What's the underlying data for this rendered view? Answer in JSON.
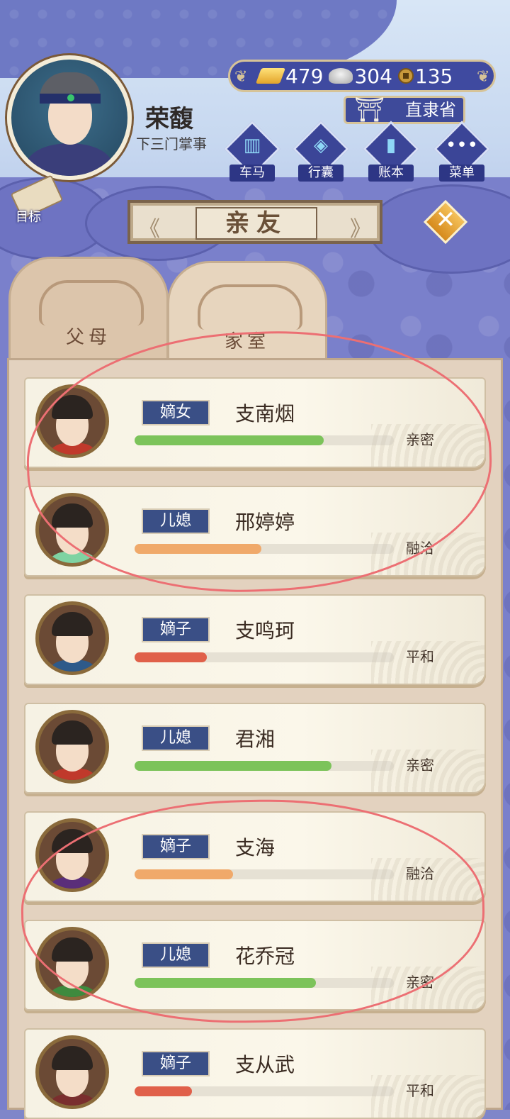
{
  "player": {
    "name": "荣馥",
    "title": "下三门掌事"
  },
  "currency": {
    "gold": "479",
    "silver": "304",
    "coins": "135"
  },
  "location": "直隶省",
  "nav": [
    {
      "label": "车马",
      "icon": "carriage-icon"
    },
    {
      "label": "行囊",
      "icon": "bag-icon"
    },
    {
      "label": "账本",
      "icon": "ledger-icon"
    },
    {
      "label": "菜单",
      "icon": "menu-dots-icon"
    }
  ],
  "goal_label": "目标",
  "panel_title": "亲友",
  "tabs": [
    {
      "label": "父母"
    },
    {
      "label": "家室"
    }
  ],
  "colors": {
    "green": "#7cc35a",
    "orange": "#f0a96a",
    "red": "#e0604a",
    "badge": "#3a4f86"
  },
  "characters": [
    {
      "role": "嫡女",
      "name": "支南烟",
      "relation": "亲密",
      "affinity": 0.73,
      "bar_color": "green",
      "robe": "#c0392b"
    },
    {
      "role": "儿媳",
      "name": "邢婷婷",
      "relation": "融洽",
      "affinity": 0.49,
      "bar_color": "orange",
      "robe": "#7fd3a2"
    },
    {
      "role": "嫡子",
      "name": "支鸣珂",
      "relation": "平和",
      "affinity": 0.28,
      "bar_color": "red",
      "robe": "#2e5a8a"
    },
    {
      "role": "儿媳",
      "name": "君湘",
      "relation": "亲密",
      "affinity": 0.76,
      "bar_color": "green",
      "robe": "#c0392b"
    },
    {
      "role": "嫡子",
      "name": "支海",
      "relation": "融洽",
      "affinity": 0.38,
      "bar_color": "orange",
      "robe": "#5a2e7a"
    },
    {
      "role": "儿媳",
      "name": "花乔冠",
      "relation": "亲密",
      "affinity": 0.7,
      "bar_color": "green",
      "robe": "#3e8a3e"
    },
    {
      "role": "嫡子",
      "name": "支从武",
      "relation": "平和",
      "affinity": 0.22,
      "bar_color": "red",
      "robe": "#7a2e2e"
    }
  ]
}
